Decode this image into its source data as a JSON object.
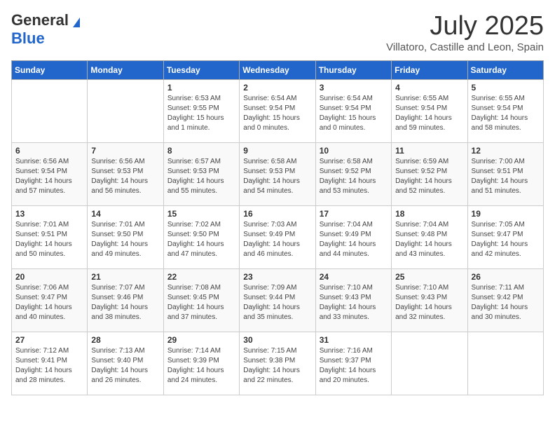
{
  "logo": {
    "general": "General",
    "blue": "Blue"
  },
  "title": {
    "month": "July 2025",
    "location": "Villatoro, Castille and Leon, Spain"
  },
  "days_of_week": [
    "Sunday",
    "Monday",
    "Tuesday",
    "Wednesday",
    "Thursday",
    "Friday",
    "Saturday"
  ],
  "weeks": [
    [
      {
        "day": "",
        "info": ""
      },
      {
        "day": "",
        "info": ""
      },
      {
        "day": "1",
        "info": "Sunrise: 6:53 AM\nSunset: 9:55 PM\nDaylight: 15 hours and 1 minute."
      },
      {
        "day": "2",
        "info": "Sunrise: 6:54 AM\nSunset: 9:54 PM\nDaylight: 15 hours and 0 minutes."
      },
      {
        "day": "3",
        "info": "Sunrise: 6:54 AM\nSunset: 9:54 PM\nDaylight: 15 hours and 0 minutes."
      },
      {
        "day": "4",
        "info": "Sunrise: 6:55 AM\nSunset: 9:54 PM\nDaylight: 14 hours and 59 minutes."
      },
      {
        "day": "5",
        "info": "Sunrise: 6:55 AM\nSunset: 9:54 PM\nDaylight: 14 hours and 58 minutes."
      }
    ],
    [
      {
        "day": "6",
        "info": "Sunrise: 6:56 AM\nSunset: 9:54 PM\nDaylight: 14 hours and 57 minutes."
      },
      {
        "day": "7",
        "info": "Sunrise: 6:56 AM\nSunset: 9:53 PM\nDaylight: 14 hours and 56 minutes."
      },
      {
        "day": "8",
        "info": "Sunrise: 6:57 AM\nSunset: 9:53 PM\nDaylight: 14 hours and 55 minutes."
      },
      {
        "day": "9",
        "info": "Sunrise: 6:58 AM\nSunset: 9:53 PM\nDaylight: 14 hours and 54 minutes."
      },
      {
        "day": "10",
        "info": "Sunrise: 6:58 AM\nSunset: 9:52 PM\nDaylight: 14 hours and 53 minutes."
      },
      {
        "day": "11",
        "info": "Sunrise: 6:59 AM\nSunset: 9:52 PM\nDaylight: 14 hours and 52 minutes."
      },
      {
        "day": "12",
        "info": "Sunrise: 7:00 AM\nSunset: 9:51 PM\nDaylight: 14 hours and 51 minutes."
      }
    ],
    [
      {
        "day": "13",
        "info": "Sunrise: 7:01 AM\nSunset: 9:51 PM\nDaylight: 14 hours and 50 minutes."
      },
      {
        "day": "14",
        "info": "Sunrise: 7:01 AM\nSunset: 9:50 PM\nDaylight: 14 hours and 49 minutes."
      },
      {
        "day": "15",
        "info": "Sunrise: 7:02 AM\nSunset: 9:50 PM\nDaylight: 14 hours and 47 minutes."
      },
      {
        "day": "16",
        "info": "Sunrise: 7:03 AM\nSunset: 9:49 PM\nDaylight: 14 hours and 46 minutes."
      },
      {
        "day": "17",
        "info": "Sunrise: 7:04 AM\nSunset: 9:49 PM\nDaylight: 14 hours and 44 minutes."
      },
      {
        "day": "18",
        "info": "Sunrise: 7:04 AM\nSunset: 9:48 PM\nDaylight: 14 hours and 43 minutes."
      },
      {
        "day": "19",
        "info": "Sunrise: 7:05 AM\nSunset: 9:47 PM\nDaylight: 14 hours and 42 minutes."
      }
    ],
    [
      {
        "day": "20",
        "info": "Sunrise: 7:06 AM\nSunset: 9:47 PM\nDaylight: 14 hours and 40 minutes."
      },
      {
        "day": "21",
        "info": "Sunrise: 7:07 AM\nSunset: 9:46 PM\nDaylight: 14 hours and 38 minutes."
      },
      {
        "day": "22",
        "info": "Sunrise: 7:08 AM\nSunset: 9:45 PM\nDaylight: 14 hours and 37 minutes."
      },
      {
        "day": "23",
        "info": "Sunrise: 7:09 AM\nSunset: 9:44 PM\nDaylight: 14 hours and 35 minutes."
      },
      {
        "day": "24",
        "info": "Sunrise: 7:10 AM\nSunset: 9:43 PM\nDaylight: 14 hours and 33 minutes."
      },
      {
        "day": "25",
        "info": "Sunrise: 7:10 AM\nSunset: 9:43 PM\nDaylight: 14 hours and 32 minutes."
      },
      {
        "day": "26",
        "info": "Sunrise: 7:11 AM\nSunset: 9:42 PM\nDaylight: 14 hours and 30 minutes."
      }
    ],
    [
      {
        "day": "27",
        "info": "Sunrise: 7:12 AM\nSunset: 9:41 PM\nDaylight: 14 hours and 28 minutes."
      },
      {
        "day": "28",
        "info": "Sunrise: 7:13 AM\nSunset: 9:40 PM\nDaylight: 14 hours and 26 minutes."
      },
      {
        "day": "29",
        "info": "Sunrise: 7:14 AM\nSunset: 9:39 PM\nDaylight: 14 hours and 24 minutes."
      },
      {
        "day": "30",
        "info": "Sunrise: 7:15 AM\nSunset: 9:38 PM\nDaylight: 14 hours and 22 minutes."
      },
      {
        "day": "31",
        "info": "Sunrise: 7:16 AM\nSunset: 9:37 PM\nDaylight: 14 hours and 20 minutes."
      },
      {
        "day": "",
        "info": ""
      },
      {
        "day": "",
        "info": ""
      }
    ]
  ]
}
